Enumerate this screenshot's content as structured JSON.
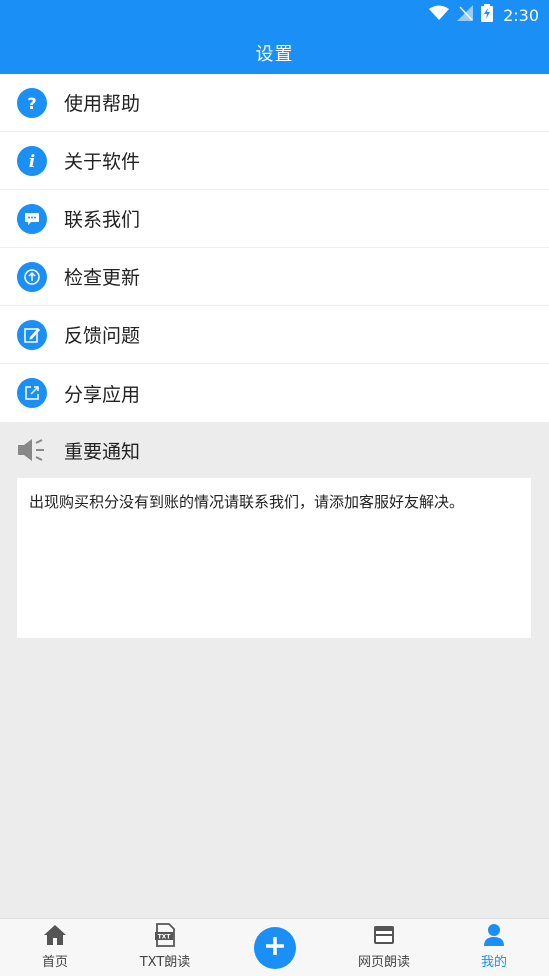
{
  "status_bar": {
    "time": "2:30"
  },
  "header": {
    "title": "设置"
  },
  "menu": {
    "items": [
      {
        "label": "使用帮助",
        "icon": "help-icon"
      },
      {
        "label": "关于软件",
        "icon": "info-icon"
      },
      {
        "label": "联系我们",
        "icon": "chat-icon"
      },
      {
        "label": "检查更新",
        "icon": "update-icon"
      },
      {
        "label": "反馈问题",
        "icon": "edit-icon"
      },
      {
        "label": "分享应用",
        "icon": "share-icon"
      }
    ]
  },
  "notice": {
    "title": "重要通知",
    "text": "出现购买积分没有到账的情况请联系我们，请添加客服好友解决。"
  },
  "tabbar": {
    "tabs": [
      {
        "label": "首页",
        "icon": "home-icon"
      },
      {
        "label": "TXT朗读",
        "icon": "txt-file-icon"
      },
      {
        "label": "",
        "icon": "plus-icon"
      },
      {
        "label": "网页朗读",
        "icon": "web-page-icon"
      },
      {
        "label": "我的",
        "icon": "person-icon"
      }
    ],
    "active_tab": "我的"
  },
  "colors": {
    "accent": "#1a8ff6",
    "background": "#ececec"
  }
}
